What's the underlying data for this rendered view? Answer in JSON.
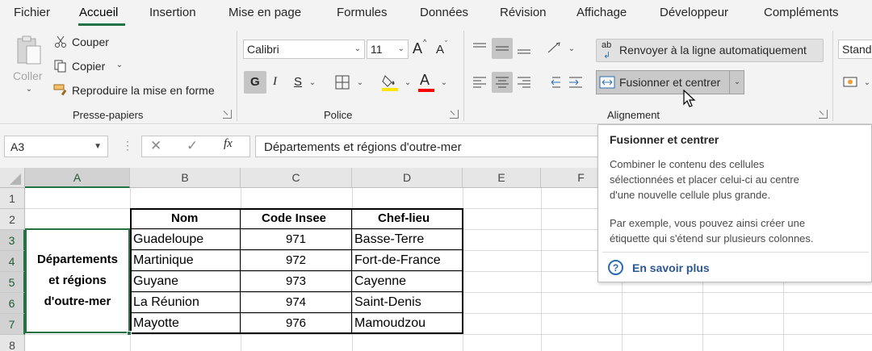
{
  "menu": {
    "tabs": [
      "Fichier",
      "Accueil",
      "Insertion",
      "Mise en page",
      "Formules",
      "Données",
      "Révision",
      "Affichage",
      "Développeur",
      "Compléments"
    ],
    "active": "Accueil"
  },
  "ribbon": {
    "clipboard": {
      "paste": "Coller",
      "cut": "Couper",
      "copy": "Copier",
      "format_painter": "Reproduire la mise en forme",
      "group_label": "Presse-papiers"
    },
    "font": {
      "font_name": "Calibri",
      "font_size": "11",
      "bold": "G",
      "italic": "I",
      "underline": "S",
      "font_color_letter": "A",
      "grow_letter": "A",
      "shrink_letter": "A",
      "group_label": "Police"
    },
    "alignment": {
      "wrap_text": "Renvoyer à la ligne automatiquement",
      "merge_center": "Fusionner et centrer",
      "group_label": "Alignement",
      "wrap_icon_letters": "ab"
    },
    "number": {
      "format": "Stand"
    },
    "colors": {
      "highlight": "#ffe600",
      "font_color": "#ff0000",
      "accent": "#217346"
    }
  },
  "formula_bar": {
    "name_box": "A3",
    "fx": "fx",
    "formula": "Départements et régions d'outre-mer"
  },
  "sheet": {
    "columns": [
      "A",
      "B",
      "C",
      "D",
      "E",
      "F"
    ],
    "rows": [
      "1",
      "2",
      "3",
      "4",
      "5",
      "6",
      "7",
      "8"
    ],
    "merged_cell_lines": [
      "Départements",
      "et régions",
      "d'outre-mer"
    ],
    "headers": [
      "Nom",
      "Code Insee",
      "Chef-lieu"
    ],
    "data": [
      [
        "Guadeloupe",
        "971",
        "Basse-Terre"
      ],
      [
        "Martinique",
        "972",
        "Fort-de-France"
      ],
      [
        "Guyane",
        "973",
        "Cayenne"
      ],
      [
        "La Réunion",
        "974",
        "Saint-Denis"
      ],
      [
        "Mayotte",
        "976",
        "Mamoudzou"
      ]
    ]
  },
  "tooltip": {
    "title": "Fusionner et centrer",
    "body1": [
      "Combiner le contenu des cellules",
      "sélectionnées et placer celui-ci au centre",
      "d'une nouvelle cellule plus grande."
    ],
    "body2": [
      "Par exemple, vous pouvez ainsi créer une",
      "étiquette qui s'étend sur plusieurs colonnes."
    ],
    "link": "En savoir plus",
    "help_glyph": "?"
  }
}
